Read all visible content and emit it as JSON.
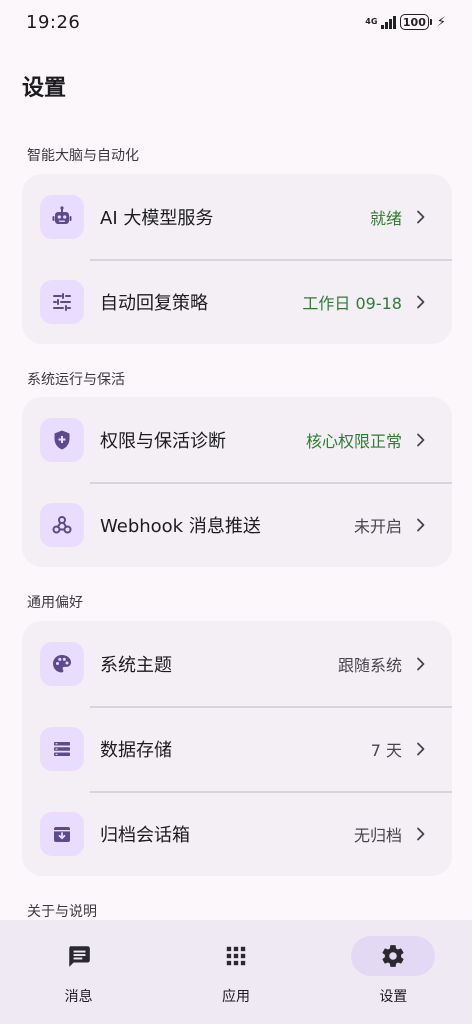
{
  "status_bar": {
    "time": "19:26",
    "network": "4G",
    "battery": "100"
  },
  "page": {
    "title": "设置"
  },
  "sections": [
    {
      "label": "智能大脑与自动化",
      "items": [
        {
          "icon": "robot-icon",
          "title": "AI 大模型服务",
          "value": "就绪",
          "value_color": "#2e7d32"
        },
        {
          "icon": "sliders-icon",
          "title": "自动回复策略",
          "value": "工作日 09-18",
          "value_color": "#2e7d32"
        }
      ]
    },
    {
      "label": "系统运行与保活",
      "items": [
        {
          "icon": "shield-plus-icon",
          "title": "权限与保活诊断",
          "value": "核心权限正常",
          "value_color": "#2e7d32"
        },
        {
          "icon": "webhook-icon",
          "title": "Webhook 消息推送",
          "value": "未开启",
          "value_color": "#46444c"
        }
      ]
    },
    {
      "label": "通用偏好",
      "items": [
        {
          "icon": "palette-icon",
          "title": "系统主题",
          "value": "跟随系统",
          "value_color": "#46444c"
        },
        {
          "icon": "storage-icon",
          "title": "数据存储",
          "value": "7 天",
          "value_color": "#46444c"
        },
        {
          "icon": "archive-icon",
          "title": "归档会话箱",
          "value": "无归档",
          "value_color": "#46444c"
        }
      ]
    },
    {
      "label": "关于与说明",
      "items": []
    }
  ],
  "bottom_nav": [
    {
      "icon": "message-icon",
      "label": "消息",
      "active": false
    },
    {
      "icon": "apps-grid-icon",
      "label": "应用",
      "active": false
    },
    {
      "icon": "gear-icon",
      "label": "设置",
      "active": true
    }
  ],
  "colors": {
    "accent_icon": "#5b4a8c",
    "icon_bg": "#e9ddff",
    "status_green": "#2e7d32"
  }
}
